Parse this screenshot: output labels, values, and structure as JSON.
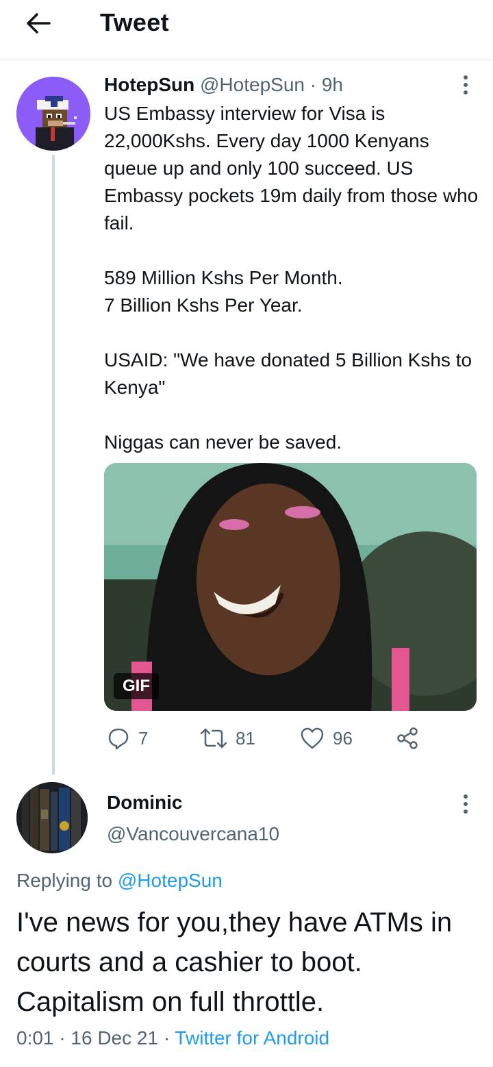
{
  "header": {
    "title": "Tweet",
    "back_icon": "arrow-left-icon"
  },
  "tweet": {
    "display_name": "HotepSun",
    "handle": "@HotepSun",
    "separator": "·",
    "time": "9h",
    "text": "US Embassy interview for Visa is 22,000Kshs. Every day 1000 Kenyans queue up and only 100 succeed. US Embassy pockets 19m daily from those who fail.\n\n589 Million Kshs Per Month.\n7 Billion Kshs Per Year.\n\nUSAID: \"We have donated 5 Billion Kshs to Kenya\"\n\nNiggas can never be saved.",
    "media_badge": "GIF",
    "replies": "7",
    "retweets": "81",
    "likes": "96",
    "icons": [
      "reply-icon",
      "retweet-icon",
      "like-icon",
      "share-icon",
      "more-icon"
    ]
  },
  "reply": {
    "display_name": "Dominic",
    "handle": "@Vancouvercana10",
    "replying_prefix": "Replying to",
    "replying_to": "@HotepSun",
    "text": "I've news for you,they have ATMs in courts and a cashier to boot. Capitalism on full throttle.",
    "time": "0:01",
    "separator": "·",
    "date": "16 Dec 21",
    "source": "Twitter for Android"
  },
  "colors": {
    "text": "#0f1419",
    "secondary": "#536471",
    "link": "#1d9bf0",
    "divider": "#e6e9eb",
    "thread_line": "#cfd9de"
  }
}
